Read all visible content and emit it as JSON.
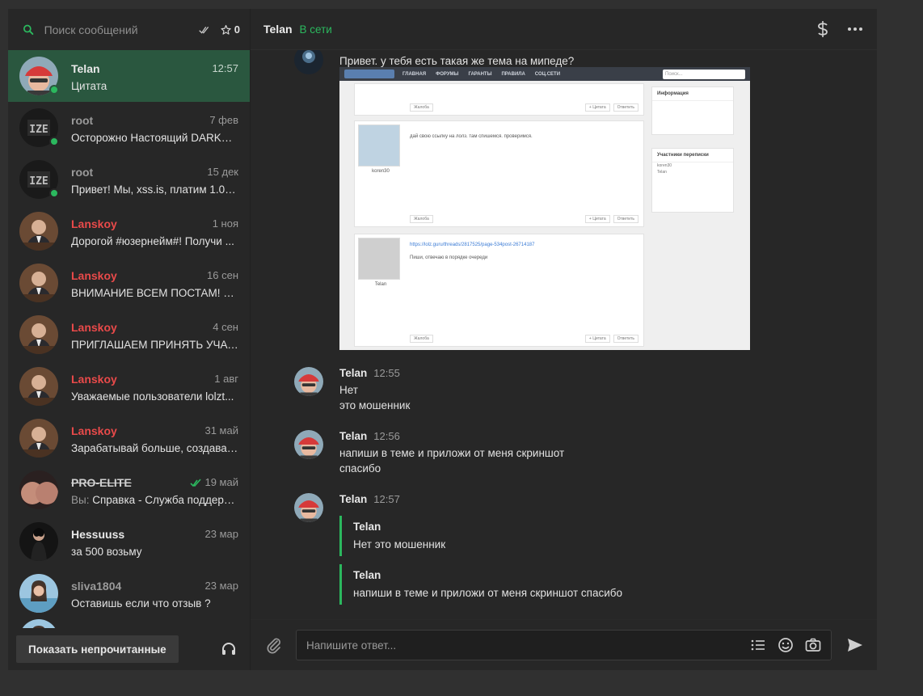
{
  "search": {
    "placeholder": "Поиск сообщений",
    "favorites_count": "0"
  },
  "conversations": [
    {
      "name": "Telan",
      "time": "12:57",
      "preview": "Цитата",
      "name_style": "normal",
      "online": true,
      "active": true,
      "avatar": "red-cap"
    },
    {
      "name": "root",
      "time": "7 фев",
      "preview": "Осторожно Настоящий DARKNET...",
      "name_style": "muted",
      "online": true,
      "avatar": "dark-logo"
    },
    {
      "name": "root",
      "time": "15 дек",
      "preview": "Привет! Мы, xss.is, платим 1.000...",
      "name_style": "muted",
      "online": true,
      "avatar": "dark-logo"
    },
    {
      "name": "Lanskoy",
      "time": "1 ноя",
      "preview": "Дорогой #юзернейм#! Получи ...",
      "name_style": "red",
      "avatar": "suit"
    },
    {
      "name": "Lanskoy",
      "time": "16 сен",
      "preview": "ВНИМАНИЕ ВСЕМ ПОСТАМ! AL...",
      "name_style": "red",
      "avatar": "suit"
    },
    {
      "name": "Lanskoy",
      "time": "4 сен",
      "preview": "ПРИГЛАШАЕМ ПРИНЯТЬ УЧАСТ...",
      "name_style": "red",
      "avatar": "suit"
    },
    {
      "name": "Lanskoy",
      "time": "1 авг",
      "preview": "Уважаемые пользователи lolzt...",
      "name_style": "red",
      "avatar": "suit"
    },
    {
      "name": "Lanskoy",
      "time": "31 май",
      "preview": "Зарабатывай больше, создавая...",
      "name_style": "red",
      "avatar": "suit"
    },
    {
      "name": "PRO-ELITE",
      "time": "19 май",
      "you_prefix": "Вы:",
      "preview": "Справка - Служба поддерж...",
      "name_style": "strike",
      "read_tick": true,
      "avatar": "skin"
    },
    {
      "name": "Hessuuss",
      "time": "23 мар",
      "preview": "за 500 возьму",
      "name_style": "normal",
      "avatar": "dark-figure"
    },
    {
      "name": "sliva1804",
      "time": "23 мар",
      "preview": "Оставишь если что отзыв ?",
      "name_style": "muted",
      "avatar": "girl"
    }
  ],
  "sidebar_footer": {
    "unread_button": "Показать непрочитанные"
  },
  "chat": {
    "title": "Telan",
    "status": "В сети",
    "first_message": "Привет. у тебя есть такая же тема на мипеде?",
    "embedded_screenshot": {
      "nav": [
        "ГЛАВНАЯ",
        "ФОРУМЫ",
        "ГАРАНТЫ",
        "ПРАВИЛА",
        "СОЦ.СЕТИ"
      ],
      "search_placeholder": "Поиск...",
      "post1_text": "дай свою ссылку на лолз. там спишемся. проверимся.",
      "post1_name": "koren30",
      "post2_link": "https://lolz.guru/threads/2817525/page-534post-26714187",
      "post2_text": "Пиши, отвечаю в порядке очереди",
      "post2_name": "Telan",
      "flag_btn": "Жалоба",
      "quote_btn": "+ Цитата",
      "reply_btn": "Ответить",
      "info_title": "Информация",
      "participants_title": "Участники переписки"
    },
    "messages": [
      {
        "author": "Telan",
        "time": "12:55",
        "lines": [
          "Нет",
          "это мошенник"
        ]
      },
      {
        "author": "Telan",
        "time": "12:56",
        "lines": [
          "напиши в теме и приложи от меня скриншот",
          "спасибо"
        ]
      },
      {
        "author": "Telan",
        "time": "12:57",
        "quotes": [
          {
            "author": "Telan",
            "text": "Нет это мошенник"
          },
          {
            "author": "Telan",
            "text": "напиши в теме и приложи от меня скриншот спасибо"
          }
        ]
      }
    ]
  },
  "composer": {
    "placeholder": "Напишите ответ..."
  },
  "colors": {
    "accent": "#2bb85e",
    "active_row": "#2a573f",
    "red_name": "#e94a4a",
    "bg": "#272727"
  }
}
